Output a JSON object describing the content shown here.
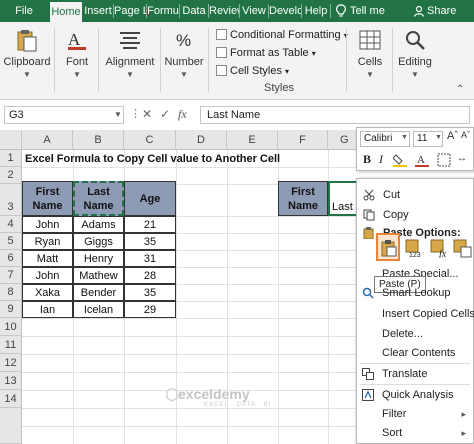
{
  "colors": {
    "ribbon_green": "#217346",
    "table_header_fill": "#8e9bb5",
    "selection_green": "#217346",
    "paste_highlight": "#e8833a"
  },
  "ribbon": {
    "tabs": [
      "File",
      "Home",
      "Insert",
      "Page L",
      "Formu",
      "Data",
      "Review",
      "View",
      "Develo",
      "Help",
      "Tell me",
      "Share"
    ],
    "active_tab": "Home",
    "tell_me_icon": "lightbulb-icon",
    "share_icon": "person-icon",
    "groups": {
      "clipboard": "Clipboard",
      "font": "Font",
      "alignment": "Alignment",
      "number": "Number",
      "cells": "Cells",
      "editing": "Editing"
    },
    "styles": {
      "conditional_formatting": "Conditional Formatting",
      "format_as_table": "Format as Table",
      "cell_styles": "Cell Styles",
      "group_label": "Styles"
    }
  },
  "formula_bar": {
    "name_box": "G3",
    "fx": "fx",
    "value": "Last Name"
  },
  "sheet": {
    "columns": [
      "A",
      "B",
      "C",
      "D",
      "E",
      "F",
      "G"
    ],
    "rows": [
      "1",
      "2",
      "3",
      "4",
      "5",
      "6",
      "7",
      "8",
      "9",
      "10",
      "11",
      "12",
      "13",
      "14"
    ],
    "title": "Excel Formula to Copy Cell value to Another Cell",
    "headers": [
      "First Name",
      "Last Name",
      "Age"
    ],
    "data": [
      [
        "John",
        "Adams",
        "21"
      ],
      [
        "Ryan",
        "Giggs",
        "35"
      ],
      [
        "Matt",
        "Henry",
        "31"
      ],
      [
        "John",
        "Mathew",
        "28"
      ],
      [
        "Xaka",
        "Bender",
        "35"
      ],
      [
        "Ian",
        "Icelan",
        "29"
      ]
    ],
    "dest_header": "First Name",
    "dest_partial": "Last N"
  },
  "mini_toolbar": {
    "font": "Calibri",
    "size": "11"
  },
  "context_menu": {
    "cut": "Cut",
    "copy": "Copy",
    "paste_options": "Paste Options:",
    "paste_special": "Paste Special...",
    "smart_lookup": "Smart Lookup",
    "insert_copied": "Insert Copied Cells...",
    "delete": "Delete...",
    "clear_contents": "Clear Contents",
    "translate": "Translate",
    "quick_analysis": "Quick Analysis",
    "filter": "Filter",
    "sort": "Sort",
    "tooltip": "Paste (P)"
  },
  "watermark": {
    "brand": "exceldemy",
    "tagline": "EXCEL · DATA · BI"
  }
}
